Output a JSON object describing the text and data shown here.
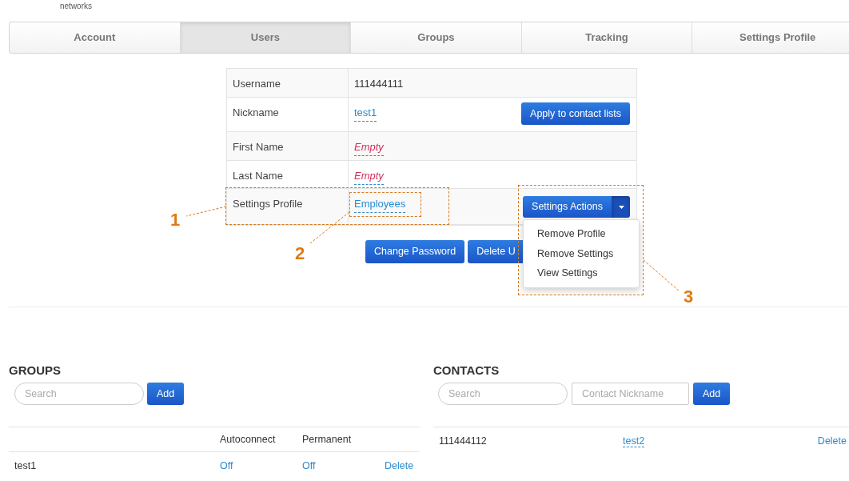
{
  "header_text": "networks",
  "tabs": [
    {
      "label": "Account",
      "selected": false
    },
    {
      "label": "Users",
      "selected": true
    },
    {
      "label": "Groups",
      "selected": false
    },
    {
      "label": "Tracking",
      "selected": false
    },
    {
      "label": "Settings Profile",
      "selected": false
    }
  ],
  "user_table": {
    "rows": [
      {
        "label": "Username",
        "value": "111444111",
        "kind": "text"
      },
      {
        "label": "Nickname",
        "value": "test1",
        "kind": "link",
        "button": "Apply to contact lists"
      },
      {
        "label": "First Name",
        "value": "Empty",
        "kind": "empty"
      },
      {
        "label": "Last Name",
        "value": "Empty",
        "kind": "empty"
      },
      {
        "label": "Settings Profile",
        "value": "Employees",
        "kind": "link",
        "dropdown": {
          "label": "Settings Actions",
          "expanded": true,
          "menu": [
            "Remove Profile",
            "Remove Settings",
            "View Settings"
          ]
        }
      }
    ]
  },
  "buttons": [
    "Change Password",
    "Delete U"
  ],
  "annotations": [
    "1",
    "2",
    "3"
  ],
  "groups": {
    "title": "GROUPS",
    "search": {
      "placeholder": "Search"
    },
    "add_button": "Add",
    "columns": [
      "Autoconnect",
      "Permanent"
    ],
    "rows": [
      {
        "name": "test1",
        "autoconnect": "Off",
        "permanent": "Off",
        "action": "Delete"
      }
    ]
  },
  "contacts": {
    "title": "CONTACTS",
    "search": {
      "placeholder": "Search"
    },
    "nickname": {
      "placeholder": "Contact Nickname"
    },
    "add_button": "Add",
    "rows": [
      {
        "number": "111444112",
        "nickname": "test2",
        "action": "Delete"
      }
    ]
  }
}
